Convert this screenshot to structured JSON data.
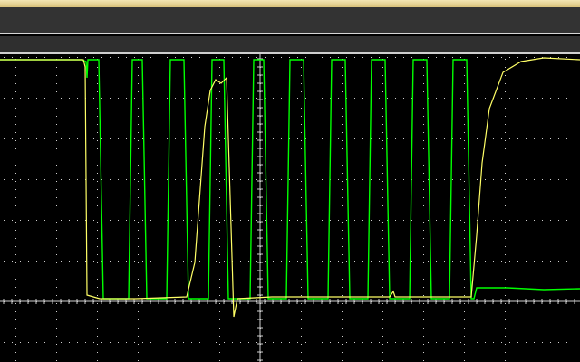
{
  "window": {
    "accent_color": "#e8d493",
    "toolbar_color": "#333333",
    "status_color": "#2f2f2f"
  },
  "scope": {
    "grid_color": "#cfcfcf",
    "channel1_color": "#00ff00",
    "channel2_color": "#ffff66"
  }
}
